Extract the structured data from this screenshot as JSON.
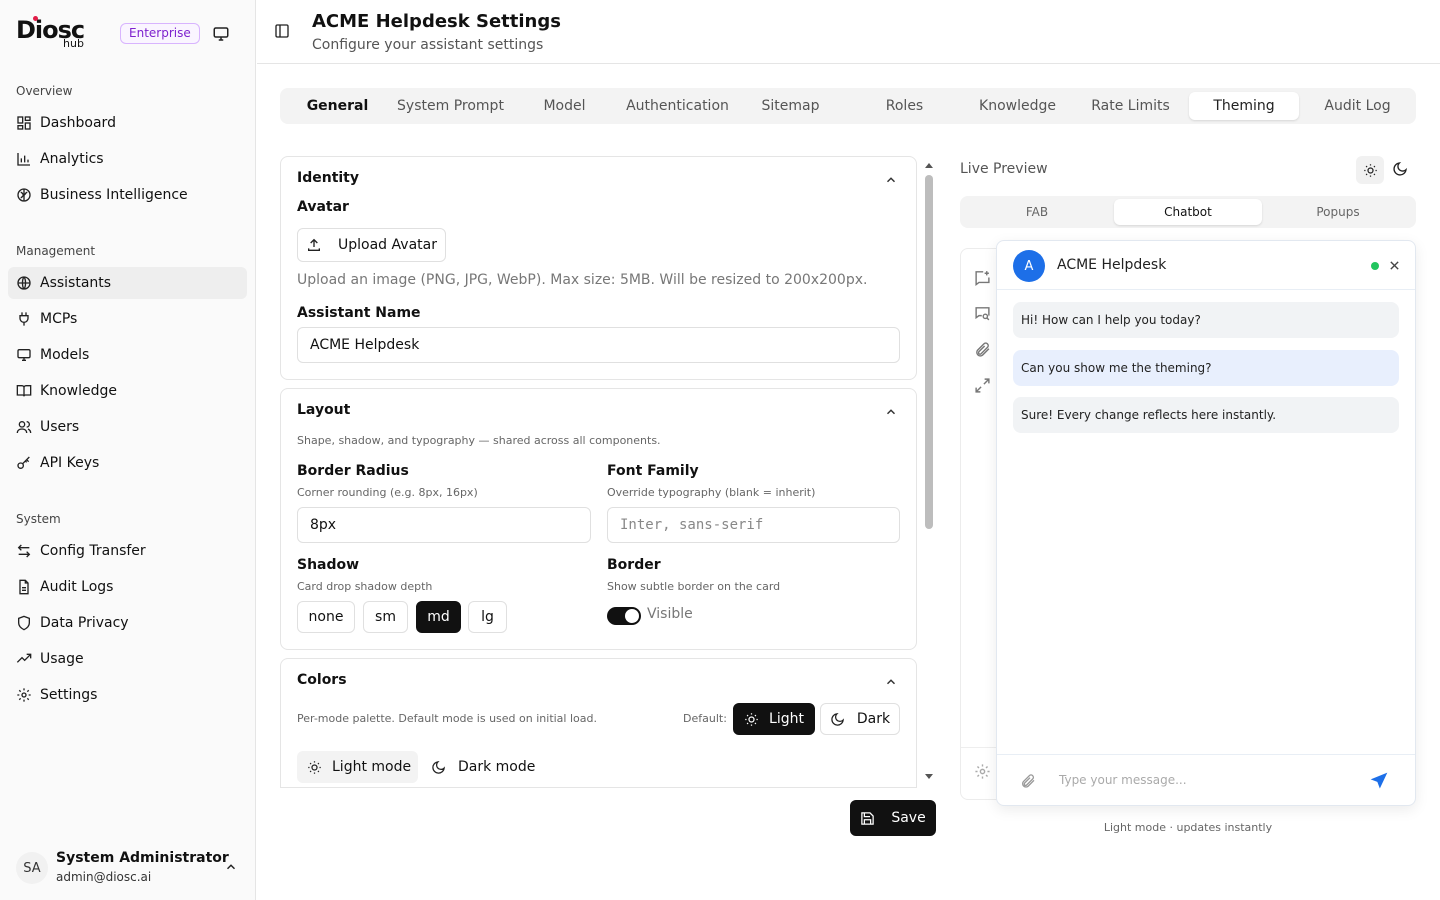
{
  "brand": {
    "name": "Diosc",
    "sub": "hub",
    "edition": "Enterprise"
  },
  "sidebar": {
    "sections": [
      {
        "title": "Overview",
        "items": [
          {
            "label": "Dashboard",
            "icon": "dashboard-icon"
          },
          {
            "label": "Analytics",
            "icon": "bar-chart-icon"
          },
          {
            "label": "Business Intelligence",
            "icon": "brain-icon"
          }
        ]
      },
      {
        "title": "Management",
        "items": [
          {
            "label": "Assistants",
            "icon": "globe-icon",
            "active": true
          },
          {
            "label": "MCPs",
            "icon": "plug-icon"
          },
          {
            "label": "Models",
            "icon": "monitor-icon"
          },
          {
            "label": "Knowledge",
            "icon": "book-icon"
          },
          {
            "label": "Users",
            "icon": "users-icon"
          },
          {
            "label": "API Keys",
            "icon": "key-icon"
          }
        ]
      },
      {
        "title": "System",
        "items": [
          {
            "label": "Config Transfer",
            "icon": "arrows-icon"
          },
          {
            "label": "Audit Logs",
            "icon": "file-icon"
          },
          {
            "label": "Data Privacy",
            "icon": "shield-icon"
          },
          {
            "label": "Usage",
            "icon": "trend-icon"
          },
          {
            "label": "Settings",
            "icon": "gear-icon"
          }
        ]
      }
    ],
    "user": {
      "initials": "SA",
      "name": "System Administrator",
      "email": "admin@diosc.ai"
    }
  },
  "header": {
    "title": "ACME Helpdesk Settings",
    "subtitle": "Configure your assistant settings"
  },
  "tabs": [
    "General",
    "System Prompt",
    "Model",
    "Authentication",
    "Sitemap",
    "Roles",
    "Knowledge",
    "Rate Limits",
    "Theming",
    "Audit Log"
  ],
  "active_tab": "Theming",
  "identity": {
    "title": "Identity",
    "avatar_label": "Avatar",
    "upload_button": "Upload Avatar",
    "upload_hint": "Upload an image (PNG, JPG, WebP). Max size: 5MB. Will be resized to 200x200px.",
    "name_label": "Assistant Name",
    "name_value": "ACME Helpdesk"
  },
  "layout": {
    "title": "Layout",
    "description": "Shape, shadow, and typography — shared across all components.",
    "border_radius_label": "Border Radius",
    "border_radius_hint": "Corner rounding (e.g. 8px, 16px)",
    "border_radius_value": "8px",
    "font_family_label": "Font Family",
    "font_family_hint": "Override typography (blank = inherit)",
    "font_family_placeholder": "Inter, sans-serif",
    "shadow_label": "Shadow",
    "shadow_hint": "Card drop shadow depth",
    "shadow_options": [
      "none",
      "sm",
      "md",
      "lg"
    ],
    "shadow_selected": "md",
    "border_label": "Border",
    "border_hint": "Show subtle border on the card",
    "border_toggle_label": "Visible",
    "border_visible": true
  },
  "colors": {
    "title": "Colors",
    "description": "Per-mode palette. Default mode is used on initial load.",
    "default_label": "Default:",
    "default_options": [
      "Light",
      "Dark"
    ],
    "default_selected": "Light",
    "mode_tabs": [
      "Light mode",
      "Dark mode"
    ],
    "mode_selected": "Light mode"
  },
  "save_button": "Save",
  "preview": {
    "title": "Live Preview",
    "tabs": [
      "FAB",
      "Chatbot",
      "Popups"
    ],
    "active_tab": "Chatbot",
    "bot_initial": "A",
    "bot_name": "ACME Helpdesk",
    "messages": [
      {
        "from": "bot",
        "text": "Hi! How can I help you today?"
      },
      {
        "from": "user",
        "text": "Can you show me the theming?"
      },
      {
        "from": "bot",
        "text": "Sure! Every change reflects here instantly."
      }
    ],
    "input_placeholder": "Type your message...",
    "footer": "Light mode · updates instantly"
  },
  "colors_theme": {
    "accent": "#1d6fe8",
    "online": "#22c55e",
    "badge": "#7e22ce",
    "primary_dark": "#111111"
  }
}
